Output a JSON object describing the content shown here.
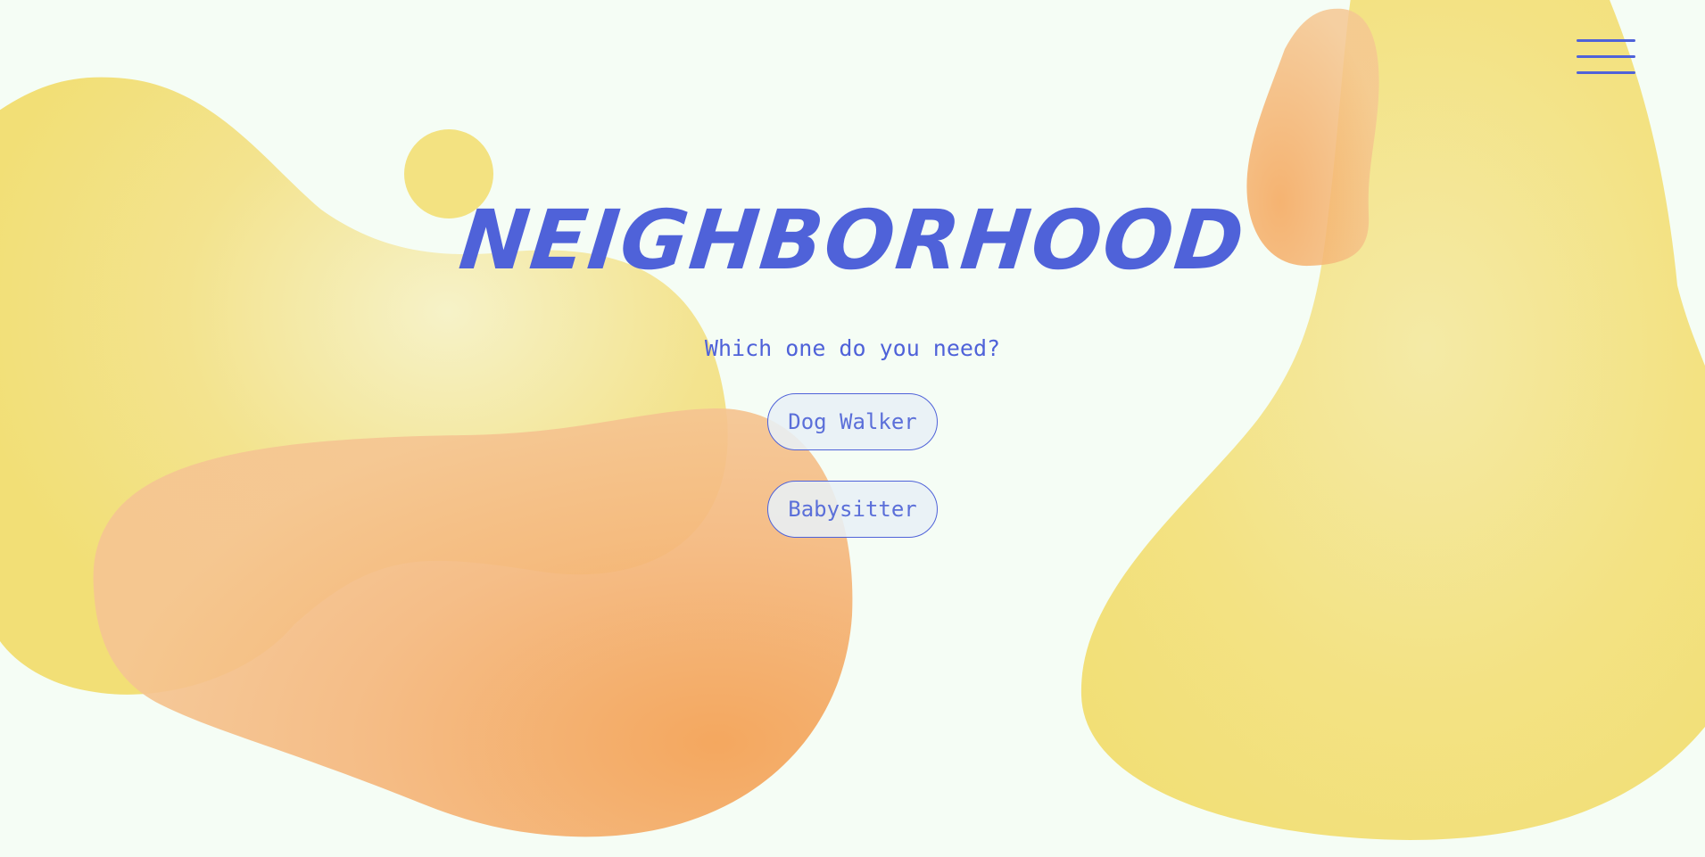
{
  "header": {
    "brand": "NEIGHBORHOOD",
    "menu_icon": "hamburger-menu-icon"
  },
  "main": {
    "prompt": "Which one do you need?",
    "options": [
      {
        "label": "Dog Walker"
      },
      {
        "label": "Babysitter"
      }
    ]
  },
  "colors": {
    "background": "#f5fdf5",
    "accent": "#4f62d9",
    "blob_yellow": "#f3e27c",
    "blob_orange": "#f4a559",
    "button_fill": "#e8f0f6"
  }
}
